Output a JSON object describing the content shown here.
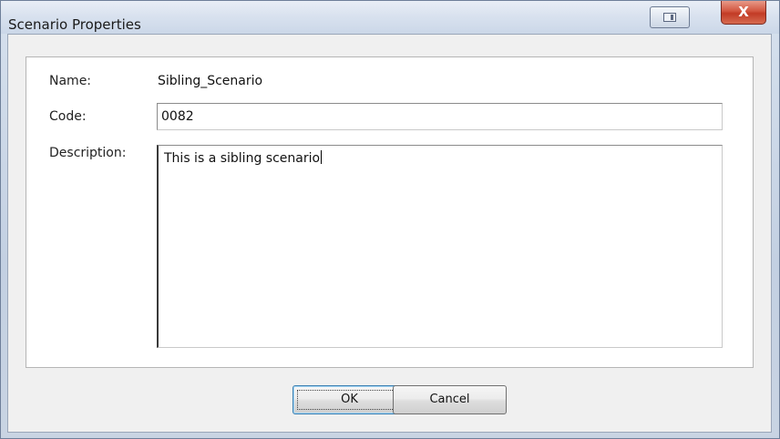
{
  "window": {
    "title": "Scenario Properties",
    "close_label": "X"
  },
  "form": {
    "name_label": "Name:",
    "name_value": "Sibling_Scenario",
    "code_label": "Code:",
    "code_value": "0082",
    "description_label": "Description:",
    "description_value": "This is a sibling scenario"
  },
  "buttons": {
    "ok_label": "OK",
    "cancel_label": "Cancel"
  },
  "icons": {
    "restore": "restore-window-icon",
    "close": "close-icon"
  },
  "colors": {
    "close_button": "#c23b25",
    "default_button_border": "#3c7fb1"
  }
}
